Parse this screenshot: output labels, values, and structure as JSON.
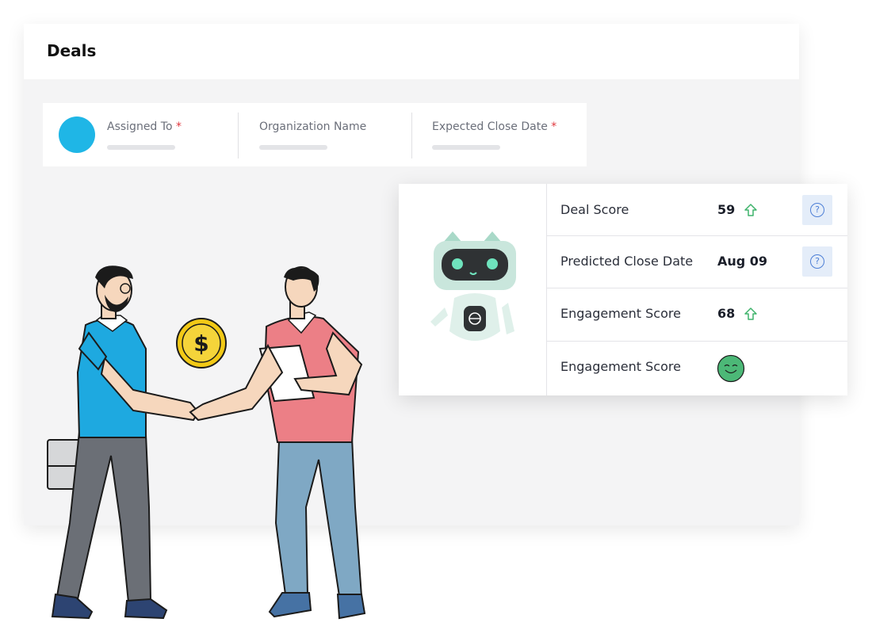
{
  "header": {
    "title": "Deals"
  },
  "fields": [
    {
      "label": "Assigned To",
      "required": "*"
    },
    {
      "label": "Organization Name",
      "required": ""
    },
    {
      "label": "Expected Close Date",
      "required": "*"
    }
  ],
  "scores": [
    {
      "label": "Deal Score",
      "value": "59",
      "trend_icon": "arrow-up-icon",
      "help_icon": "question-icon"
    },
    {
      "label": "Predicted Close Date",
      "value": "Aug 09",
      "help_icon": "question-icon"
    },
    {
      "label": "Engagement Score",
      "value": "68",
      "trend_icon": "arrow-up-icon"
    },
    {
      "label": "Engagement Score",
      "status_icon": "smiley-face-icon"
    }
  ],
  "colors": {
    "avatar": "#1fb6e6",
    "required": "#e0373e",
    "trend_up": "#3fb36b",
    "help": "#4d7fd6",
    "smiley": "#4cb877"
  }
}
